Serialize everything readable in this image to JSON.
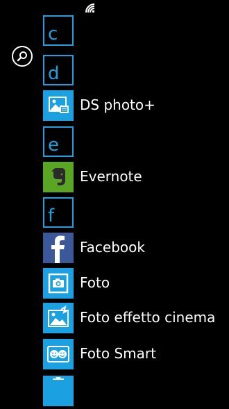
{
  "status_bar": {
    "icon": "wifi-signal-icon"
  },
  "search": {
    "icon": "search-icon"
  },
  "colors": {
    "accent": "#1ba1e2",
    "background": "#000000",
    "evernote": "#5ba525",
    "facebook": "#3b5998"
  },
  "list": {
    "letters": [
      {
        "letter": "c"
      },
      {
        "letter": "d"
      },
      {
        "letter": "e"
      },
      {
        "letter": "f"
      }
    ],
    "apps": [
      {
        "name": "DS photo+",
        "icon": "ds-photo-icon"
      },
      {
        "name": "Evernote",
        "icon": "evernote-icon"
      },
      {
        "name": "Facebook",
        "icon": "facebook-icon"
      },
      {
        "name": "Foto",
        "icon": "camera-icon"
      },
      {
        "name": "Foto effetto cinema",
        "icon": "cinemagraph-icon"
      },
      {
        "name": "Foto Smart",
        "icon": "smart-shoot-icon"
      }
    ]
  }
}
